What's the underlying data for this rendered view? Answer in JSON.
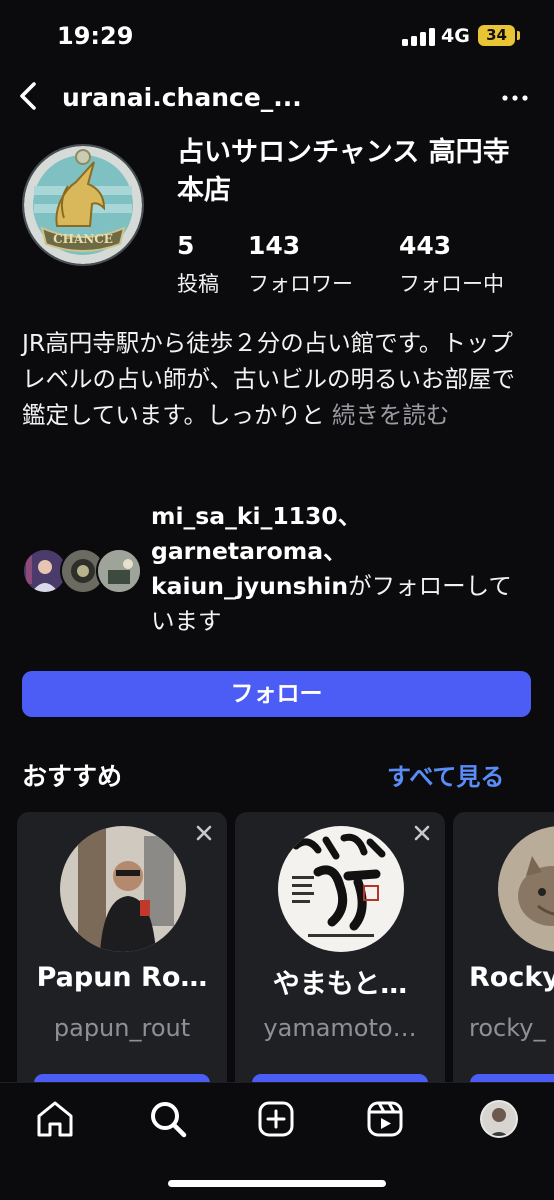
{
  "status_bar": {
    "time": "19:29",
    "network": "4G",
    "battery": "34"
  },
  "header": {
    "username": "uranai.chance_..."
  },
  "profile": {
    "display_name": "占いサロンチャンス 高円寺本店",
    "stats": [
      {
        "value": "5",
        "label": "投稿"
      },
      {
        "value": "143",
        "label": "フォロワー"
      },
      {
        "value": "443",
        "label": "フォロー中"
      }
    ],
    "bio": "JR高円寺駅から徒歩２分の占い館です。トップレベルの占い師が、古いビルの明るいお部屋で鑑定しています。しっかりと",
    "bio_more": " 続きを読む"
  },
  "followed_by": {
    "names": "mi_sa_ki_1130、garnetaroma、kaiun_jyunshin",
    "suffix": "がフォローしています"
  },
  "follow_button": {
    "label": "フォロー"
  },
  "suggestions": {
    "title": "おすすめ",
    "see_all": "すべて見る",
    "cards": [
      {
        "name": "Papun Ro…",
        "handle": "papun_rout"
      },
      {
        "name": "やまもと…",
        "handle": "yamamoto…"
      },
      {
        "name": "Rocky",
        "handle": "rocky_"
      }
    ]
  },
  "colors": {
    "accent": "#4c5df5",
    "link": "#5a8df7",
    "background": "#0b0b0d",
    "card": "#1f2024",
    "battery": "#e9c434"
  },
  "tab_bar": {
    "icons": [
      "home-icon",
      "search-icon",
      "create-icon",
      "reels-icon",
      "profile-avatar"
    ]
  }
}
